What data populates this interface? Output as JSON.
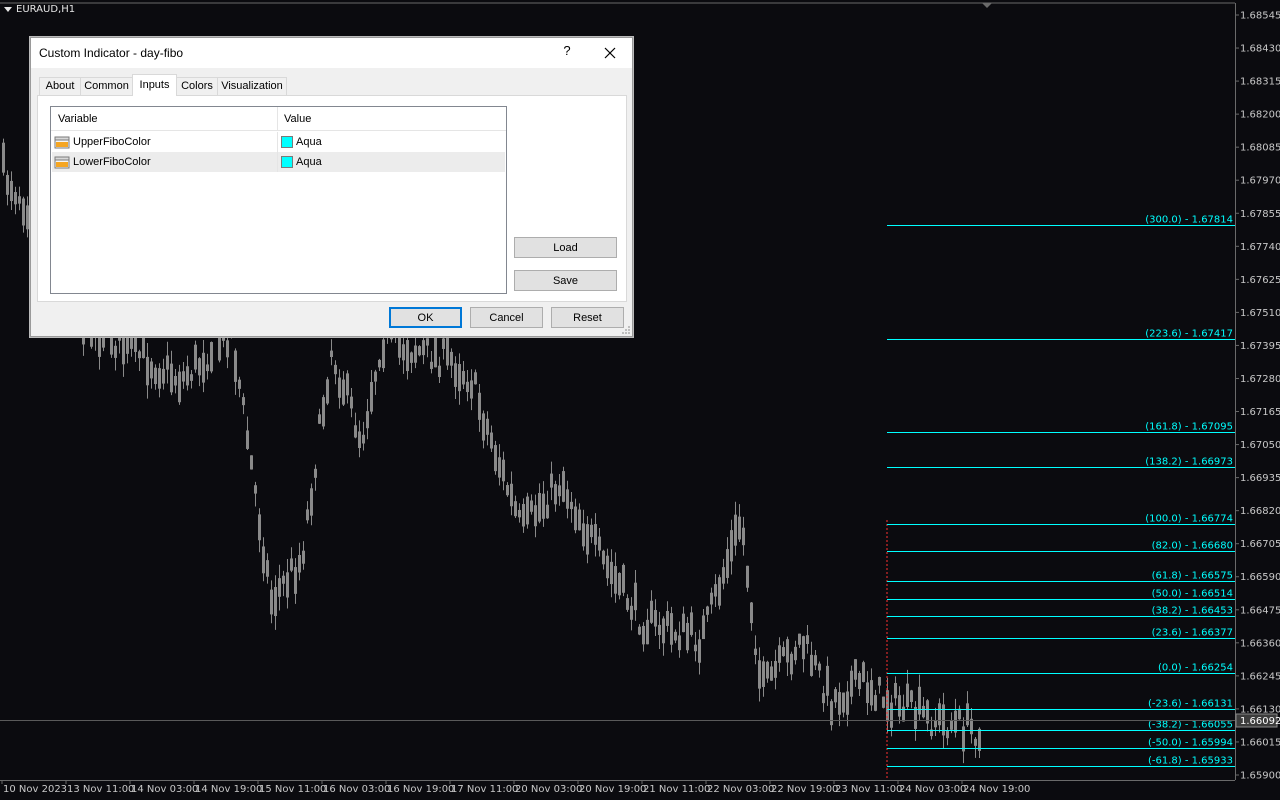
{
  "chart": {
    "symbol": "EURAUD,H1",
    "current_price": "1.66092",
    "colors": {
      "background": "#0b0b0f",
      "candle": "#8a8a8a",
      "fibo": "#00ffff",
      "axis_text": "#c8c8c8",
      "vline": "#ff3030"
    },
    "price_axis": [
      "1.68545",
      "1.68430",
      "1.68315",
      "1.68200",
      "1.68085",
      "1.67970",
      "1.67855",
      "1.67740",
      "1.67625",
      "1.67510",
      "1.67395",
      "1.67280",
      "1.67165",
      "1.67050",
      "1.66935",
      "1.66820",
      "1.66705",
      "1.66590",
      "1.66475",
      "1.66360",
      "1.66245",
      "1.66130",
      "1.66015",
      "1.65900"
    ],
    "time_axis": [
      "10 Nov 2023",
      "13 Nov 11:00",
      "14 Nov 03:00",
      "14 Nov 19:00",
      "15 Nov 11:00",
      "16 Nov 03:00",
      "16 Nov 19:00",
      "17 Nov 11:00",
      "20 Nov 03:00",
      "20 Nov 19:00",
      "21 Nov 11:00",
      "22 Nov 03:00",
      "22 Nov 19:00",
      "23 Nov 11:00",
      "24 Nov 03:00",
      "24 Nov 19:00"
    ],
    "fibo_levels": [
      {
        "level": "300.0",
        "price": "1.67814",
        "label": "(300.0) - 1.67814"
      },
      {
        "level": "223.6",
        "price": "1.67417",
        "label": "(223.6) - 1.67417"
      },
      {
        "level": "161.8",
        "price": "1.67095",
        "label": "(161.8) - 1.67095"
      },
      {
        "level": "138.2",
        "price": "1.66973",
        "label": "(138.2) - 1.66973"
      },
      {
        "level": "100.0",
        "price": "1.66774",
        "label": "(100.0) - 1.66774"
      },
      {
        "level": "82.0",
        "price": "1.66680",
        "label": "(82.0) - 1.66680"
      },
      {
        "level": "61.8",
        "price": "1.66575",
        "label": "(61.8) - 1.66575"
      },
      {
        "level": "50.0",
        "price": "1.66514",
        "label": "(50.0) - 1.66514"
      },
      {
        "level": "38.2",
        "price": "1.66453",
        "label": "(38.2) - 1.66453"
      },
      {
        "level": "23.6",
        "price": "1.66377",
        "label": "(23.6) - 1.66377"
      },
      {
        "level": "0.0",
        "price": "1.66254",
        "label": "(0.0) - 1.66254"
      },
      {
        "level": "-23.6",
        "price": "1.66131",
        "label": "(-23.6) - 1.66131"
      },
      {
        "level": "-38.2",
        "price": "1.66055",
        "label": "(-38.2) - 1.66055"
      },
      {
        "level": "-50.0",
        "price": "1.65994",
        "label": "(-50.0) - 1.65994"
      },
      {
        "level": "-61.8",
        "price": "1.65933",
        "label": "(-61.8) - 1.65933"
      }
    ]
  },
  "dialog": {
    "title": "Custom Indicator - day-fibo",
    "help": "?",
    "tabs": [
      {
        "label": "About",
        "active": false
      },
      {
        "label": "Common",
        "active": false
      },
      {
        "label": "Inputs",
        "active": true
      },
      {
        "label": "Colors",
        "active": false
      },
      {
        "label": "Visualization",
        "active": false
      }
    ],
    "grid": {
      "headers": {
        "variable": "Variable",
        "value": "Value"
      },
      "rows": [
        {
          "variable": "UpperFiboColor",
          "value": "Aqua",
          "swatch": "#00ffff",
          "selected": false
        },
        {
          "variable": "LowerFiboColor",
          "value": "Aqua",
          "swatch": "#00ffff",
          "selected": true
        }
      ]
    },
    "buttons": {
      "load": "Load",
      "save": "Save",
      "ok": "OK",
      "cancel": "Cancel",
      "reset": "Reset"
    }
  }
}
